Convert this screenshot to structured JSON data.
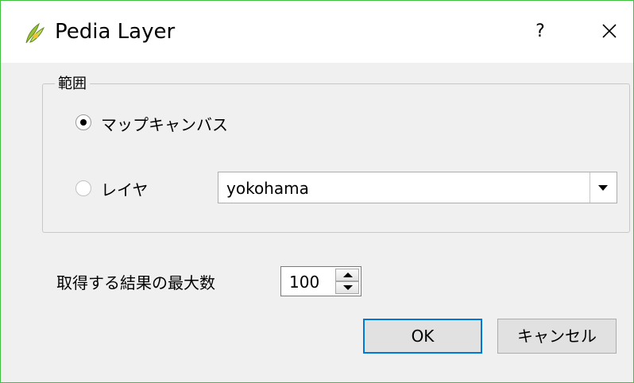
{
  "window": {
    "title": "Pedia Layer",
    "help_label": "?",
    "accent_color": "#3ec23e"
  },
  "extent_group": {
    "title": "範囲",
    "options": [
      {
        "label": "マップキャンバス",
        "checked": true
      },
      {
        "label": "レイヤ",
        "checked": false
      }
    ],
    "layer_combo": {
      "value": "yokohama"
    }
  },
  "max_results": {
    "label": "取得する結果の最大数",
    "value": "100"
  },
  "buttons": {
    "ok": "OK",
    "cancel": "キャンセル"
  }
}
